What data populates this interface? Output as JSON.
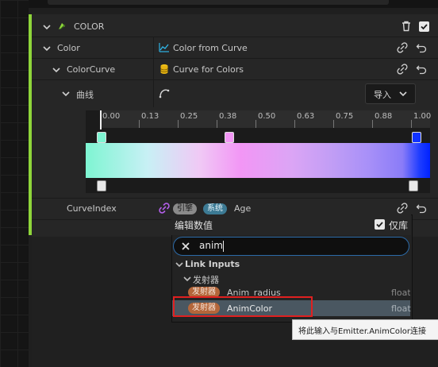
{
  "section": {
    "title": "COLOR"
  },
  "rows": {
    "color": {
      "label": "Color",
      "value": "Color from Curve"
    },
    "colorcurve": {
      "label": "ColorCurve",
      "value": "Curve for Colors"
    },
    "curve": {
      "label": "曲线",
      "import_label": "导入"
    },
    "curveindex": {
      "label": "CurveIndex",
      "pill_engine": "引擎",
      "pill_system": "系统",
      "value": "Age"
    }
  },
  "curve_ticks": [
    "0.00",
    "0.13",
    "0.25",
    "0.38",
    "0.50",
    "0.63",
    "0.75",
    "0.88",
    "1.00"
  ],
  "popup": {
    "title": "编辑数值",
    "library_only_label": "仅库",
    "library_only_checked": true,
    "search_value": "anim",
    "category": "Link Inputs",
    "subcategory": "发射器",
    "items": [
      {
        "tag": "发射器",
        "name": "Anim_radius",
        "type": "float"
      },
      {
        "tag": "发射器",
        "name": "AnimColor",
        "type": "float"
      }
    ]
  },
  "tooltip": {
    "text": "将此输入与Emitter.AnimColor连接"
  },
  "colors": {
    "accent_green": "#8ed53a",
    "link_purple": "#b25ee8",
    "pill_engine": "#8a8a8a",
    "pill_system": "#3c7a94",
    "pill_emitter": "#b4663a",
    "selection": "#4a5761",
    "highlight_red": "#e02020"
  }
}
